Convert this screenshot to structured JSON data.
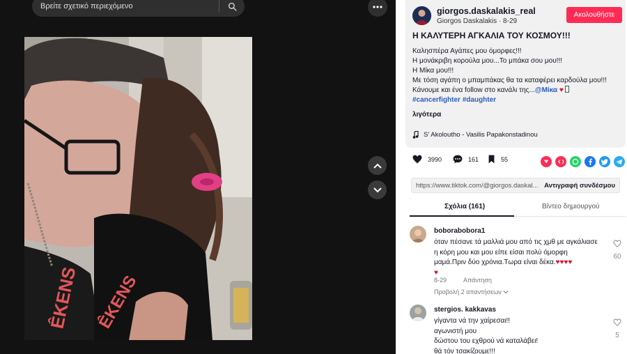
{
  "search": {
    "placeholder": "Βρείτε σχετικό περιεχόμενο"
  },
  "author": {
    "username": "giorgos.daskalakis_real",
    "display_name": "Giorgos Daskalakis",
    "date": "8-29",
    "follow_label": "Ακολουθήστε"
  },
  "post": {
    "title": "Η ΚΑΛΥΤΕΡΗ ΑΓΚΑΛΙΑ ΤΟΥ ΚΟΣΜΟΥ!!!",
    "lines": [
      "Καλησπέρα Αγάπες μου όμορφες!!!",
      "Η μονάκριβη κορούλα μου...Το μπάκα σου μου!!!",
      "Η Μίκα μου!!!",
      "Με τόση αγάπη ο μπαμπάκας θα τα καταφέρει καρδούλα μου!!!",
      "Κάνουμε και ένα follow στο κανάλι της..."
    ],
    "mention": "@Μίκα",
    "heart": "♥",
    "hashtags": "#cancerfighter #daughter",
    "more_label": "λιγότερα",
    "music": "S' Akoloutho - Vasilis Papakonstadinou"
  },
  "stats": {
    "likes": "3990",
    "comments": "161",
    "saves": "55"
  },
  "share": {
    "url": "https://www.tiktok.com/@giorgos.daskal...",
    "copy_label": "Αντιγραφή συνδέσμου"
  },
  "tabs": {
    "comments": "Σχόλια (161)",
    "creator": "Βίντεο δημιουργού"
  },
  "comments": [
    {
      "user": "boborabobora1",
      "lines": [
        "όταν πέσανε τά μαλλιά μου από τις χμθ με αγκάλιασε",
        "η κόρη μου και μου είπε είσαι πολύ όμορφη",
        "μαμά.Πριν δύο χρόνια.Τωρα είναι δέκα."
      ],
      "hearts_inline": "♥♥♥♥",
      "hearts_next_line": "♥",
      "date": "8-29",
      "reply_label": "Απάντηση",
      "view_replies": "Προβολή 2 απαντήσεων",
      "likes": "60"
    },
    {
      "user": "stergios. kakkavas",
      "lines": [
        "γίγαντα νά την χαίρεσαι!!",
        "αγωνιστή μου",
        "δώστου του εχθρού νά καταλάβει!",
        "θά τόν τσακίζουμε!!!"
      ],
      "likes": "5"
    }
  ],
  "colors": {
    "accent": "#fe2c55",
    "link": "#2b5db9",
    "dark_bg": "#121212"
  }
}
